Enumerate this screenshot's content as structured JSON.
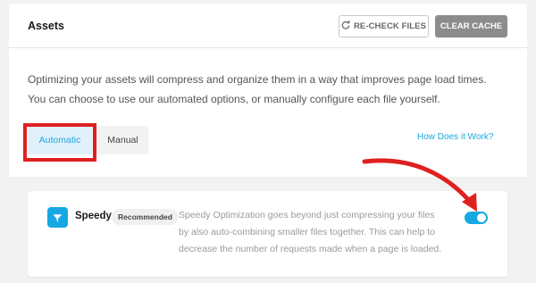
{
  "header": {
    "title": "Assets",
    "recheck_label": "RE-CHECK FILES",
    "clear_label": "CLEAR CACHE"
  },
  "description": "Optimizing your assets will compress and organize them in a way that improves page load times. You can choose to use our automated options, or manually configure each file yourself.",
  "tabs": [
    {
      "label": "Automatic",
      "active": true
    },
    {
      "label": "Manual",
      "active": false
    }
  ],
  "how_link": "How Does it Work?",
  "speedy": {
    "icon": "speedy-logo-icon",
    "name": "Speedy",
    "badge": "Recommended",
    "description": "Speedy Optimization goes beyond just compressing your files by also auto-combining smaller files together. This can help to decrease the number of requests made when a page is loaded.",
    "enabled": true
  },
  "colors": {
    "accent": "#17a8e3",
    "annotation_red": "#e02020",
    "clear_button": "#8c8c8c",
    "page_bg": "#f2f2f2"
  }
}
